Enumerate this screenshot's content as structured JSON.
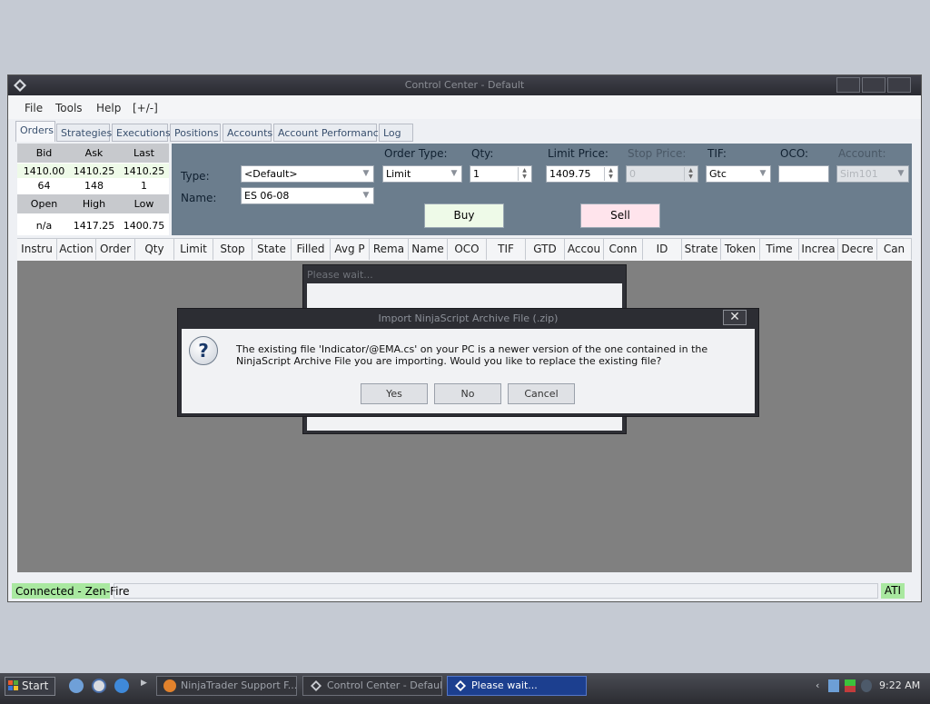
{
  "window": {
    "title": "Control Center - Default"
  },
  "menu": [
    "File",
    "Tools",
    "Help",
    "[+/-]"
  ],
  "tabs": [
    "Orders",
    "Strategies",
    "Executions",
    "Positions",
    "Accounts",
    "Account Performance",
    "Log"
  ],
  "quote": {
    "headers1": [
      "Bid",
      "Ask",
      "Last"
    ],
    "prices": [
      "1410.00",
      "1410.25",
      "1410.25"
    ],
    "sizes": [
      "64",
      "148",
      "1"
    ],
    "headers2": [
      "Open",
      "High",
      "Low"
    ],
    "stats": [
      "n/a",
      "1417.25",
      "1400.75"
    ]
  },
  "order_entry": {
    "type_label": "Type:",
    "type_value": "<Default>",
    "name_label": "Name:",
    "name_value": "ES 06-08",
    "order_type_label": "Order Type:",
    "order_type_value": "Limit",
    "qty_label": "Qty:",
    "qty_value": "1",
    "limit_price_label": "Limit Price:",
    "limit_price_value": "1409.75",
    "stop_price_label": "Stop Price:",
    "stop_price_value": "0",
    "tif_label": "TIF:",
    "tif_value": "Gtc",
    "oco_label": "OCO:",
    "oco_value": "",
    "account_label": "Account:",
    "account_value": "Sim101",
    "buy_label": "Buy",
    "sell_label": "Sell"
  },
  "grid_columns": [
    "Instru",
    "Action",
    "Order",
    "Qty",
    "Limit",
    "Stop",
    "State",
    "Filled",
    "Avg P",
    "Rema",
    "Name",
    "OCO",
    "TIF",
    "GTD",
    "Accou",
    "Conn",
    "ID",
    "Strate",
    "Token",
    "Time",
    "Increa",
    "Decre",
    "Can"
  ],
  "status": {
    "connection": "Connected - Zen-Fire",
    "right": "ATI"
  },
  "wait_window": {
    "title": "Please wait..."
  },
  "dialog": {
    "title": "Import NinjaScript Archive File (.zip)",
    "close": "✕",
    "message": "The existing file 'Indicator/@EMA.cs' on your PC is a newer version of the one contained in the NinjaScript Archive File you are importing. Would you like to replace the existing file?",
    "yes": "Yes",
    "no": "No",
    "cancel": "Cancel"
  },
  "taskbar": {
    "start": "Start",
    "tasks": [
      "NinjaTrader Support F...",
      "Control Center - Default",
      "Please wait..."
    ],
    "clock": "9:22 AM"
  },
  "colors": {
    "green_bg": "#a9e8a0",
    "buy_bg": "#eefae8",
    "sell_bg": "#ffe4ec",
    "grid_bg": "#808080",
    "entry_panel": "#6b7d8d"
  }
}
